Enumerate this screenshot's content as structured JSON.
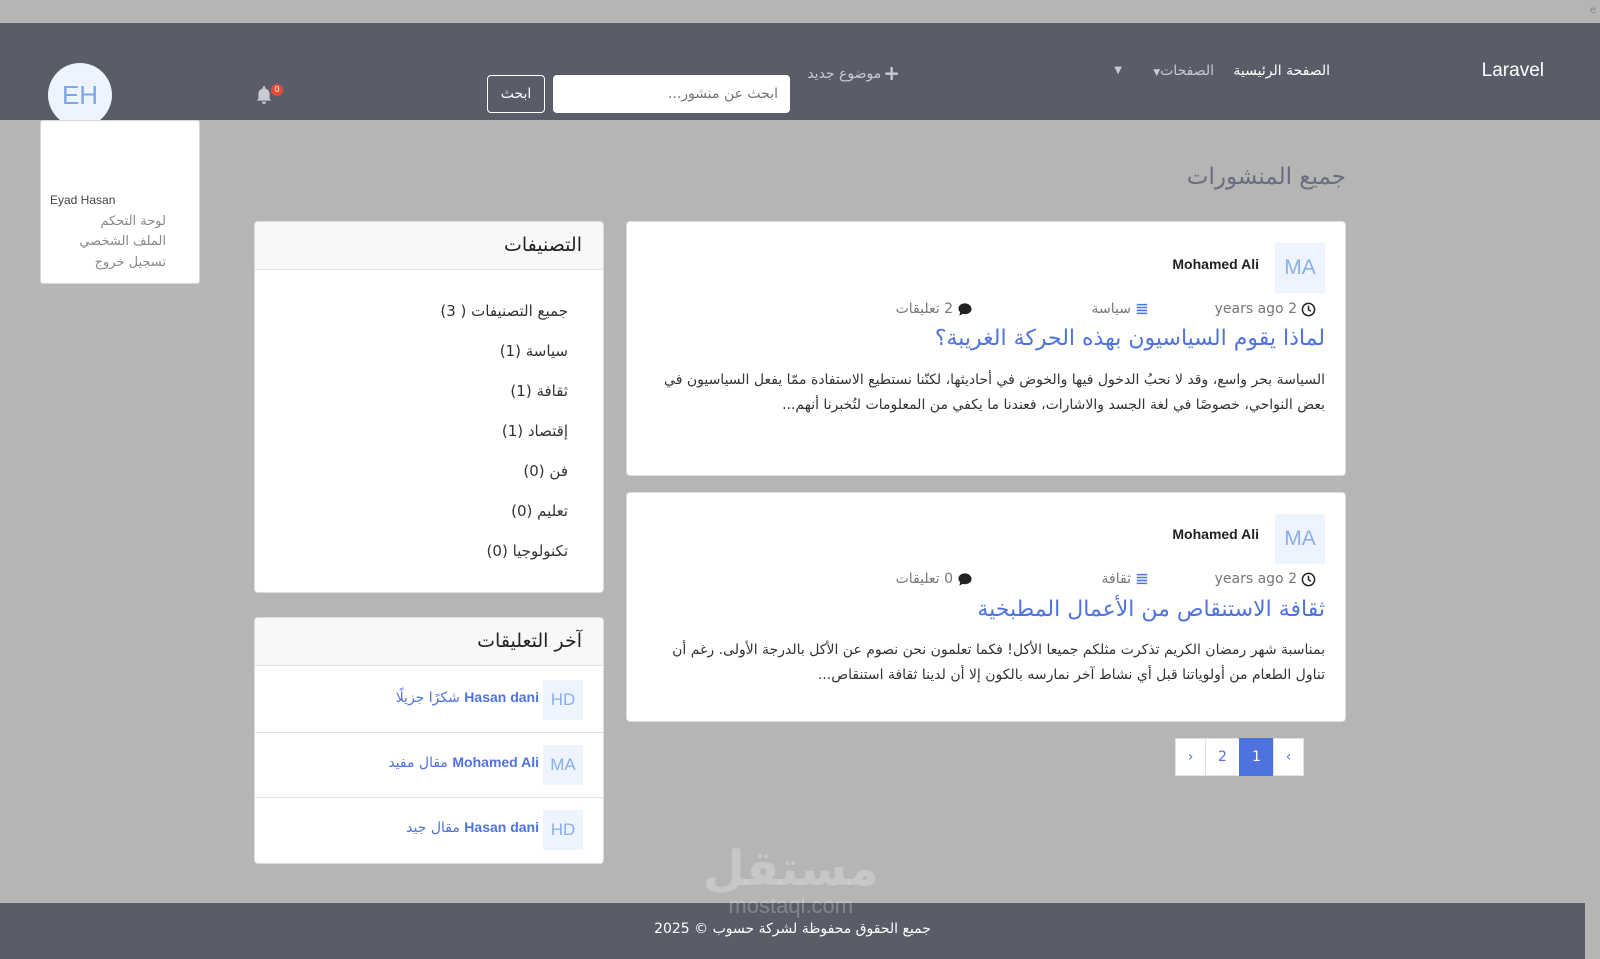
{
  "navbar": {
    "brand": "Laravel",
    "home": "الصفحة الرئيسية",
    "pages": "الصفحات",
    "new_topic": "موضوع جديد",
    "search_placeholder": "ابحث عن منشور...",
    "search_button": "ابحث",
    "notification_count": "0",
    "avatar_initials": "EH"
  },
  "user_menu": {
    "name": "Eyad Hasan",
    "items": [
      "لوحة التحكم",
      "الملف الشخصي",
      "تسجيل خروج"
    ]
  },
  "page_title": "جميع المنشورات",
  "posts": [
    {
      "avatar": "MA",
      "author": "Mohamed Ali",
      "time": "2 years ago",
      "category": "سياسة",
      "comments": "2 تعليقات",
      "title": "لماذا يقوم السياسيون بهذه الحركة الغريبة؟",
      "excerpt": "السياسة بحر واسع، وقد لا نحبُ الدخول فيها والخوض في أحاديثها، لكنّنا نستطيع الاستفادة ممّا يفعل السياسيون في بعض النواحي، خصوصًا في لغة الجسد والاشارات، فعندنا ما يكفي من المعلومات لتُخبرنا أنهم..."
    },
    {
      "avatar": "MA",
      "author": "Mohamed Ali",
      "time": "2 years ago",
      "category": "ثقافة",
      "comments": "0 تعليقات",
      "title": "ثقافة الاستنقاص من الأعمال المطبخية",
      "excerpt": "بمناسبة شهر رمضان الكريم تذكرت مثلكم جميعا الأكل! فكما تعلمون نحن نصوم عن الأكل بالدرجة الأولى. رغم أن تناول الطعام من أولوياتنا قبل أي نشاط آخر نمارسه بالكون إلا أن لدينا ثقافة استنقاص..."
    }
  ],
  "pagination": {
    "prev": "‹",
    "pages": [
      "1",
      "2"
    ],
    "next": "›"
  },
  "categories": {
    "title": "التصنيفات",
    "items": [
      "جميع التصنيفات ( 3)",
      "سياسة (1)",
      "ثقافة (1)",
      "إقتصاد (1)",
      "فن (0)",
      "تعليم (0)",
      "تكنولوجيا (0)"
    ]
  },
  "latest_comments": {
    "title": "آخر التعليقات",
    "items": [
      {
        "avatar": "HD",
        "author": "Hasan dani",
        "text": "شكرًا جزيلًا"
      },
      {
        "avatar": "MA",
        "author": "Mohamed Ali",
        "text": "مقال مفيد"
      },
      {
        "avatar": "HD",
        "author": "Hasan dani",
        "text": "مقال جيد"
      }
    ]
  },
  "footer": {
    "text": "جميع الحقوق محفوظة لشركة حسوب © 2025"
  },
  "watermark": {
    "line1": "مستقل",
    "line2": "mostaql.com"
  },
  "colors": {
    "navbar": "#5a5c69",
    "background": "#b5b5b3",
    "accent": "#4e73df",
    "badge": "#e74a3b"
  }
}
